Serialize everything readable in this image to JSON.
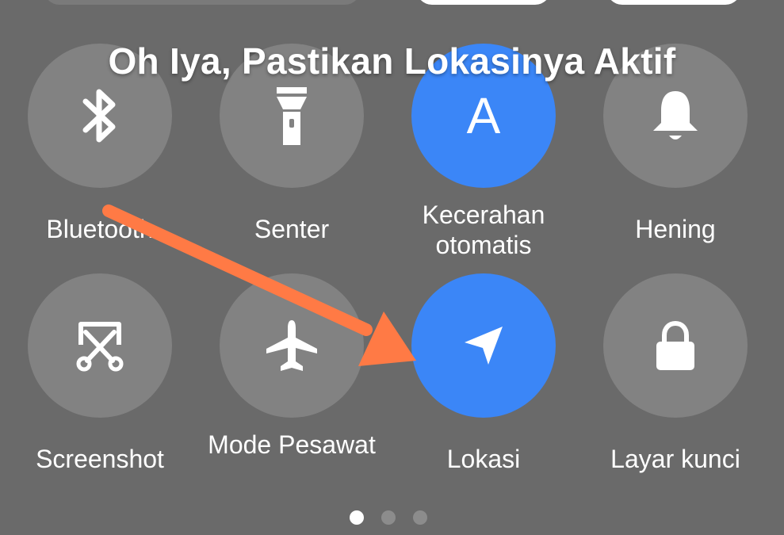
{
  "caption": "Oh Iya, Pastikan Lokasinya Aktif",
  "tiles": [
    {
      "label": "Bluetooth",
      "icon": "bluetooth-icon",
      "active": false
    },
    {
      "label": "Senter",
      "icon": "flashlight-icon",
      "active": false
    },
    {
      "label": "Kecerahan otomatis",
      "icon": "auto-brightness-icon",
      "active": true,
      "icon_text": "A"
    },
    {
      "label": "Hening",
      "icon": "bell-icon",
      "active": false
    },
    {
      "label": "Screenshot",
      "icon": "screenshot-icon",
      "active": false
    },
    {
      "label": "Mode Pesawat",
      "icon": "airplane-icon",
      "active": false
    },
    {
      "label": "Lokasi",
      "icon": "location-icon",
      "active": true
    },
    {
      "label": "Layar kunci",
      "icon": "lock-icon",
      "active": false
    }
  ],
  "pager": {
    "pages": 3,
    "current": 1
  },
  "colors": {
    "background": "#6a6a6a",
    "tile_inactive": "#828282",
    "tile_active": "#3b86f7",
    "arrow": "#ff7a45"
  }
}
